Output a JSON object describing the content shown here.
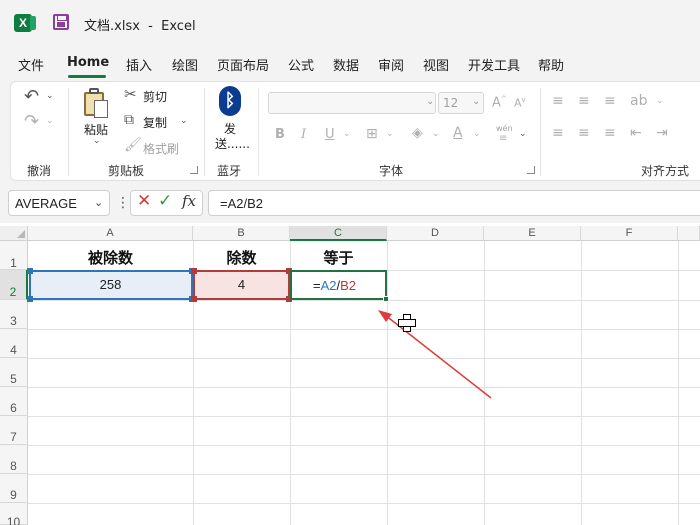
{
  "window": {
    "title": "文档.xlsx  -  Excel"
  },
  "menu": {
    "items": [
      "文件",
      "Home",
      "插入",
      "绘图",
      "页面布局",
      "公式",
      "数据",
      "审阅",
      "视图",
      "开发工具",
      "帮助"
    ],
    "active": "Home"
  },
  "ribbon": {
    "clipboard": {
      "paste": "粘贴",
      "cut": "剪切",
      "copy": "复制",
      "format_painter": "格式刷",
      "label": "剪贴板"
    },
    "undo": {
      "label": "撤消"
    },
    "bluetooth": {
      "line1": "发",
      "line2": "送......",
      "label": "蓝牙"
    },
    "font": {
      "size": "12",
      "label": "字体",
      "pinyin": "wén"
    },
    "alignment": {
      "label": "对齐方式"
    }
  },
  "formula_bar": {
    "name_box": "AVERAGE",
    "formula": "=A2/B2"
  },
  "sheet": {
    "columns": [
      "A",
      "B",
      "C",
      "D",
      "E",
      "F"
    ],
    "rows": [
      "1",
      "2",
      "3",
      "4",
      "5",
      "6",
      "7",
      "8",
      "9",
      "10"
    ],
    "headers": {
      "a1": "被除数",
      "b1": "除数",
      "c1": "等于"
    },
    "values": {
      "a2": "258",
      "b2": "4"
    },
    "formula_cell": {
      "eq": "=",
      "ref1": "A2",
      "slash": "/",
      "ref2": "B2"
    }
  },
  "colors": {
    "ref1": "#2e75b6",
    "ref2": "#b23b3b",
    "active": "#217346",
    "arrow": "#e03a3a"
  }
}
